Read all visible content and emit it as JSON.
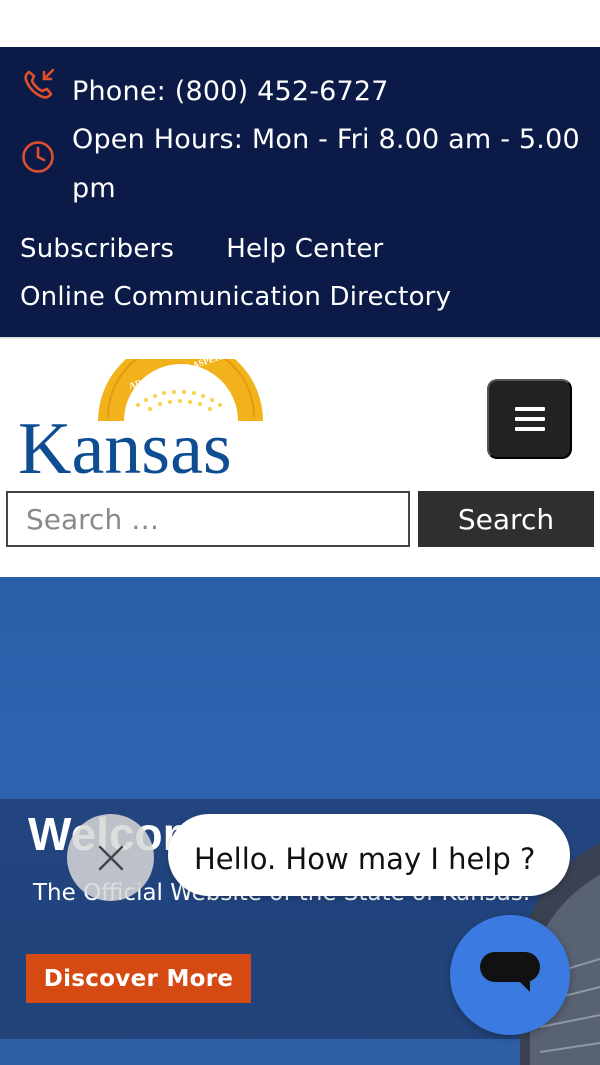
{
  "topbar": {
    "phone": "Phone: (800) 452-6727",
    "hours": "Open Hours: Mon - Fri 8.00 am - 5.00 pm",
    "links": [
      "Subscribers",
      "Help Center",
      "Online Communication Directory"
    ],
    "icons": [
      "phone-icon",
      "clock-icon"
    ],
    "accent": "#e0502a",
    "background": "#0b1a47"
  },
  "header": {
    "logo_text": "Kansas",
    "logo_motto": "AD ASTRA PER ASPERA",
    "search_placeholder": "Search …",
    "search_button": "Search",
    "menu_icon": "hamburger-icon"
  },
  "hero": {
    "title": "Welcome to Kansas",
    "subtitle": "The Official Website of the State of Kansas.",
    "button": "Discover More",
    "button_color": "#d44a12"
  },
  "chat": {
    "message": "Hello. How may I help ?",
    "launcher_color": "#3b7ae0"
  }
}
